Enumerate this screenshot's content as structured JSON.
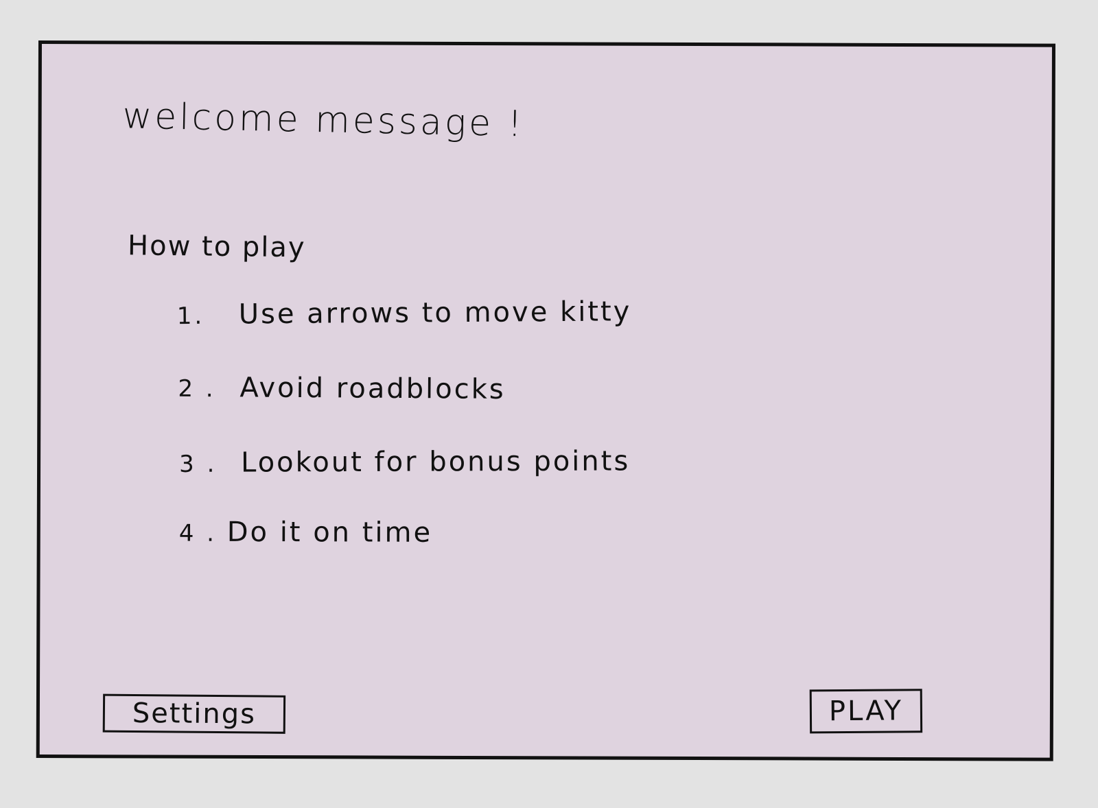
{
  "screen": {
    "welcome_text": "welcome message !",
    "how_to_play_title": "How to play",
    "steps": [
      {
        "number": "1.",
        "text": "Use arrows to move kitty"
      },
      {
        "number": "2 .",
        "text": "Avoid roadblocks"
      },
      {
        "number": "3 .",
        "text": "Lookout for bonus points"
      },
      {
        "number": "4 .",
        "text": "Do it on time"
      }
    ]
  },
  "buttons": {
    "settings_label": "Settings",
    "play_label": "PLAY"
  },
  "colors": {
    "page_background": "#e3e3e3",
    "panel_background": "#dfd3df",
    "ink": "#111111"
  }
}
